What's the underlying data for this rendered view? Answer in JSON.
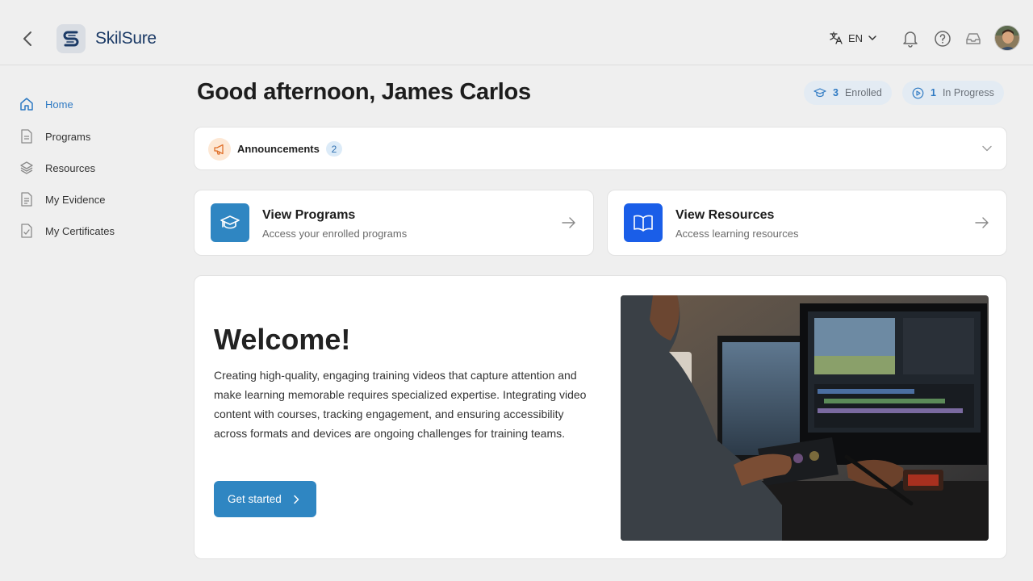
{
  "app": {
    "name": "SkilSure"
  },
  "header": {
    "language": "EN"
  },
  "sidebar": {
    "items": [
      {
        "label": "Home",
        "icon": "home-icon",
        "active": true
      },
      {
        "label": "Programs",
        "icon": "document-icon"
      },
      {
        "label": "Resources",
        "icon": "layers-icon"
      },
      {
        "label": "My Evidence",
        "icon": "file-text-icon"
      },
      {
        "label": "My Certificates",
        "icon": "certificate-file-icon"
      }
    ]
  },
  "main": {
    "greeting": "Good afternoon, James Carlos",
    "stats": {
      "enrolled_count": "3",
      "enrolled_label": "Enrolled",
      "in_progress_count": "1",
      "in_progress_label": "In Progress"
    },
    "announcements": {
      "title": "Announcements",
      "count": "2"
    },
    "quick_links": [
      {
        "title": "View Programs",
        "subtitle": "Access your enrolled programs",
        "icon": "graduation-cap-icon",
        "color": "#2f86c2"
      },
      {
        "title": "View Resources",
        "subtitle": "Access learning resources",
        "icon": "open-book-icon",
        "color": "#1a5ee8"
      }
    ],
    "welcome": {
      "title": "Welcome!",
      "body": "Creating high-quality, engaging training videos that capture attention and make learning memorable requires specialized expertise. Integrating video content with courses, tracking engagement, and ensuring accessibility across formats and devices are ongoing challenges for training teams.",
      "button_label": "Get started"
    }
  },
  "colors": {
    "accent": "#2f7ac3",
    "button": "#2f86c2",
    "brand_text": "#1b3a66"
  }
}
